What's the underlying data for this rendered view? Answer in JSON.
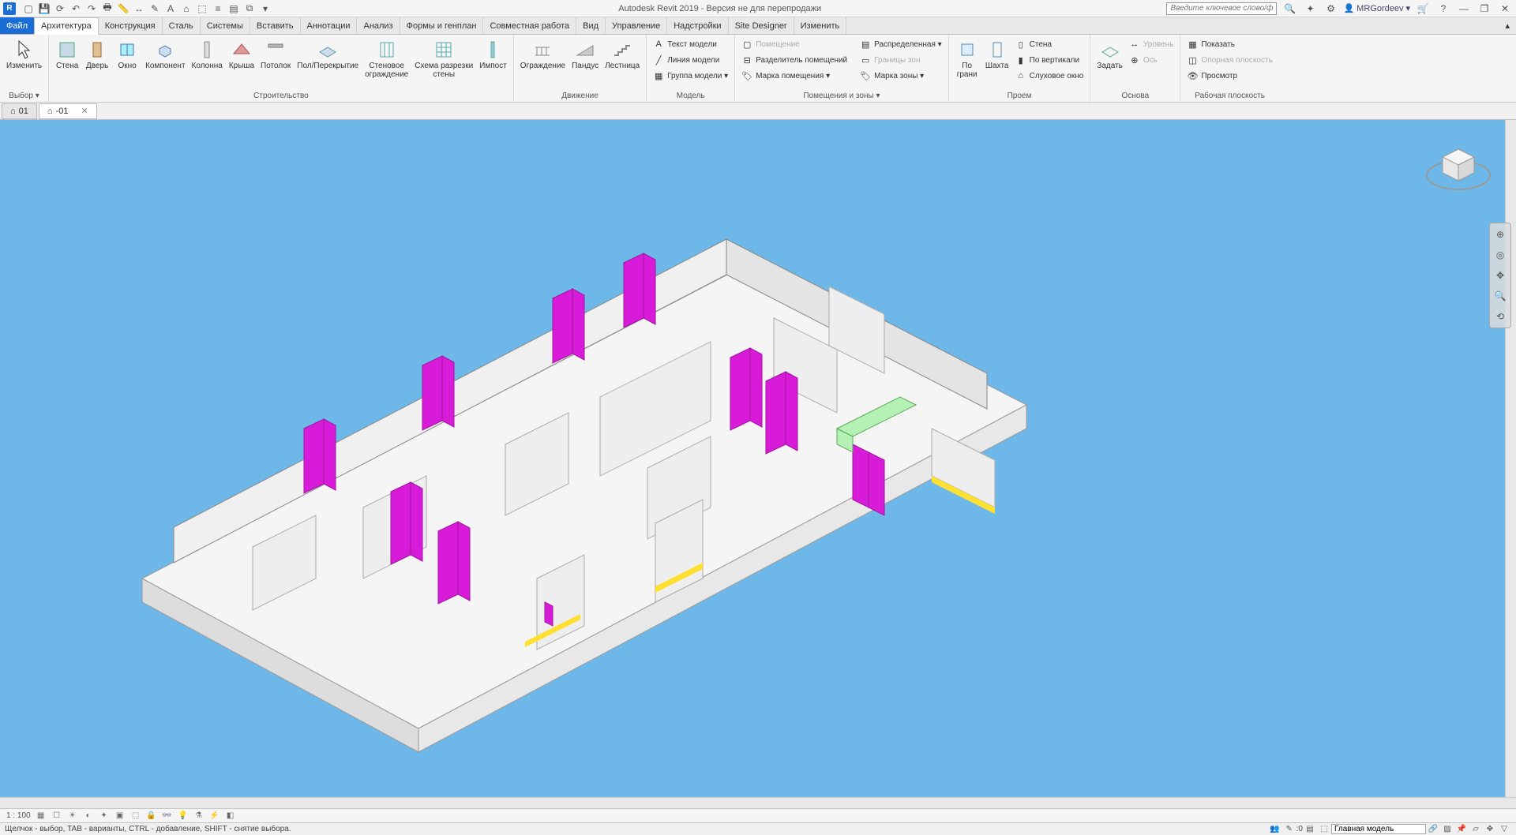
{
  "app": {
    "title": "Autodesk Revit 2019 - Версия не для перепродажи",
    "search_placeholder": "Введите ключевое слово/фразу",
    "user": "MRGordeev"
  },
  "tabs": {
    "file": "Файл",
    "items": [
      "Архитектура",
      "Конструкция",
      "Сталь",
      "Системы",
      "Вставить",
      "Аннотации",
      "Анализ",
      "Формы и генплан",
      "Совместная работа",
      "Вид",
      "Управление",
      "Надстройки",
      "Site Designer",
      "Изменить"
    ],
    "active": 0
  },
  "ribbon": {
    "select": {
      "modify": "Изменить",
      "panel": "Выбор"
    },
    "build": {
      "panel": "Строительство",
      "wall": "Стена",
      "door": "Дверь",
      "window": "Окно",
      "component": "Компонент",
      "column": "Колонна",
      "roof": "Крыша",
      "ceiling": "Потолок",
      "floor": "Пол/Перекрытие",
      "curtain": "Стеновое\nограждение",
      "mullion": "Схема разрезки\nстены",
      "impost": "Импост"
    },
    "circ": {
      "panel": "Движение",
      "railing": "Ограждение",
      "ramp": "Пандус",
      "stair": "Лестница"
    },
    "model": {
      "panel": "Модель",
      "text": "Текст модели",
      "line": "Линия модели",
      "group": "Группа модели"
    },
    "room": {
      "panel": "Помещения и зоны",
      "room": "Помещение",
      "sep": "Разделитель помещений",
      "tag": "Марка помещения",
      "zone_b": "Границы зон",
      "zone": "Распределенная",
      "zone_tag": "Марка зоны"
    },
    "opening": {
      "panel": "Проем",
      "byface": "По\nграни",
      "shaft": "Шахта",
      "wall": "Стена",
      "vert": "По вертикали",
      "dormer": "Слуховое окно"
    },
    "datum": {
      "panel": "Основа",
      "set": "Задать",
      "level": "Уровень",
      "axis": "Ось"
    },
    "work": {
      "panel": "Рабочая плоскость",
      "show": "Показать",
      "ref": "Опорная плоскость",
      "viewer": "Просмотр"
    }
  },
  "viewtabs": {
    "t1": "01",
    "t2": "-01"
  },
  "viewbar": {
    "scale": "1 : 100"
  },
  "status": {
    "hint": "Щелчок - выбор, TAB - варианты, CTRL - добавление, SHIFT - снятие выбора.",
    "sel": ":0",
    "workset": "Главная модель"
  }
}
